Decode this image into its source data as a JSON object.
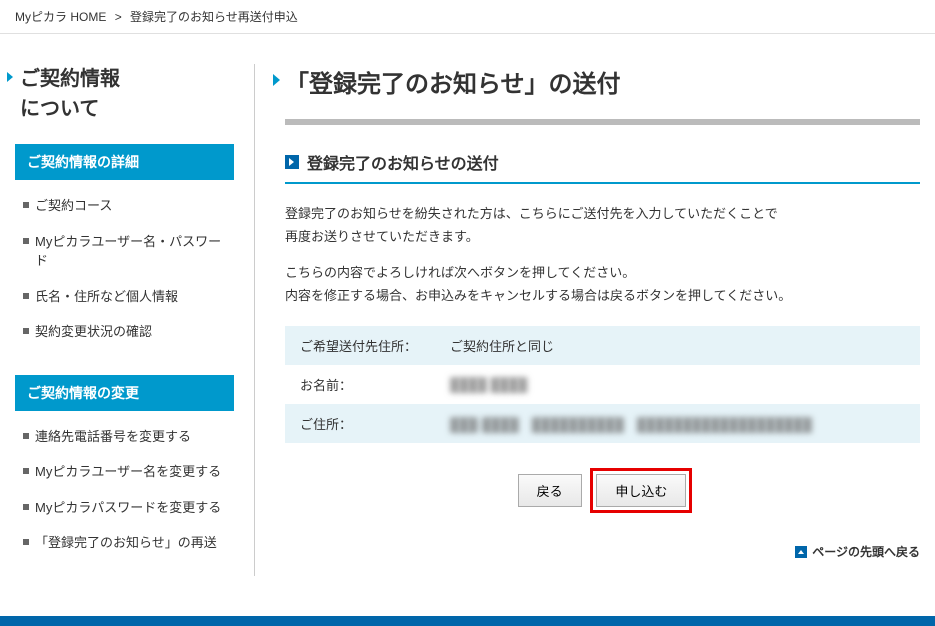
{
  "breadcrumb": {
    "home": "Myピカラ HOME",
    "current": "登録完了のお知らせ再送付申込"
  },
  "sidebar": {
    "title_line1": "ご契約情報",
    "title_line2": "について",
    "sections": [
      {
        "header": "ご契約情報の詳細",
        "items": [
          "ご契約コース",
          "Myピカラユーザー名・パスワード",
          "氏名・住所など個人情報",
          "契約変更状況の確認"
        ]
      },
      {
        "header": "ご契約情報の変更",
        "items": [
          "連絡先電話番号を変更する",
          "Myピカラユーザー名を変更する",
          "Myピカラパスワードを変更する",
          "「登録完了のお知らせ」の再送"
        ]
      }
    ]
  },
  "main": {
    "page_title": "「登録完了のお知らせ」の送付",
    "section_title": "登録完了のお知らせの送付",
    "description_p1a": "登録完了のお知らせを紛失された方は、こちらにご送付先を入力していただくことで",
    "description_p1b": "再度お送りさせていただきます。",
    "description_p2a": "こちらの内容でよろしければ次へボタンを押してください。",
    "description_p2b": "内容を修正する場合、お申込みをキャンセルする場合は戻るボタンを押してください。",
    "rows": [
      {
        "label": "ご希望送付先住所：",
        "value": "ご契約住所と同じ"
      },
      {
        "label": "お名前：",
        "value": "████ ████"
      },
      {
        "label": "ご住所：",
        "value": "███-████　██████████　███████████████████"
      }
    ],
    "buttons": {
      "back": "戻る",
      "submit": "申し込む"
    },
    "page_top": "ページの先頭へ戻る"
  }
}
